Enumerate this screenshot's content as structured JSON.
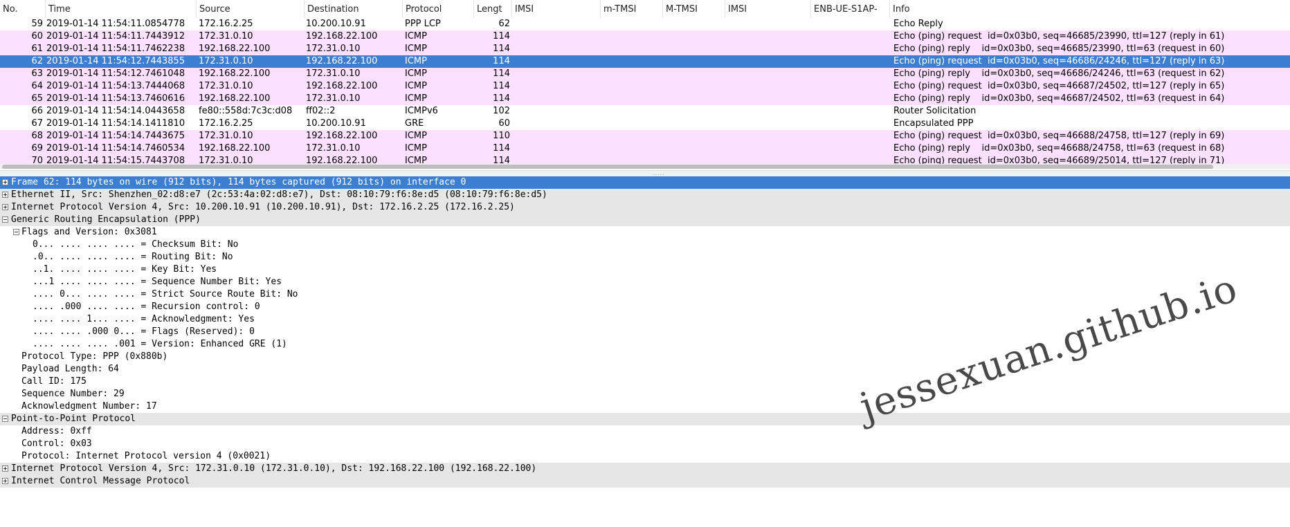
{
  "columns": [
    "No.",
    "Time",
    "Source",
    "Destination",
    "Protocol",
    "Lengt",
    "IMSI",
    "m-TMSI",
    "M-TMSI",
    "IMSI",
    "ENB-UE-S1AP-",
    "Info"
  ],
  "packets": [
    {
      "no": "59",
      "time": "2019-01-14 11:54:11.0854778",
      "src": "172.16.2.25",
      "dst": "10.200.10.91",
      "proto": "PPP LCP",
      "len": "62",
      "info": "Echo Reply",
      "style": "white"
    },
    {
      "no": "60",
      "time": "2019-01-14 11:54:11.7443912",
      "src": "172.31.0.10",
      "dst": "192.168.22.100",
      "proto": "ICMP",
      "len": "114",
      "info": "Echo (ping) request  id=0x03b0, seq=46685/23990, ttl=127 (reply in 61)",
      "style": "pink"
    },
    {
      "no": "61",
      "time": "2019-01-14 11:54:11.7462238",
      "src": "192.168.22.100",
      "dst": "172.31.0.10",
      "proto": "ICMP",
      "len": "114",
      "info": "Echo (ping) reply    id=0x03b0, seq=46685/23990, ttl=63 (request in 60)",
      "style": "pink"
    },
    {
      "no": "62",
      "time": "2019-01-14 11:54:12.7443855",
      "src": "172.31.0.10",
      "dst": "192.168.22.100",
      "proto": "ICMP",
      "len": "114",
      "info": "Echo (ping) request  id=0x03b0, seq=46686/24246, ttl=127 (reply in 63)",
      "style": "selected"
    },
    {
      "no": "63",
      "time": "2019-01-14 11:54:12.7461048",
      "src": "192.168.22.100",
      "dst": "172.31.0.10",
      "proto": "ICMP",
      "len": "114",
      "info": "Echo (ping) reply    id=0x03b0, seq=46686/24246, ttl=63 (request in 62)",
      "style": "pink"
    },
    {
      "no": "64",
      "time": "2019-01-14 11:54:13.7444068",
      "src": "172.31.0.10",
      "dst": "192.168.22.100",
      "proto": "ICMP",
      "len": "114",
      "info": "Echo (ping) request  id=0x03b0, seq=46687/24502, ttl=127 (reply in 65)",
      "style": "pink"
    },
    {
      "no": "65",
      "time": "2019-01-14 11:54:13.7460616",
      "src": "192.168.22.100",
      "dst": "172.31.0.10",
      "proto": "ICMP",
      "len": "114",
      "info": "Echo (ping) reply    id=0x03b0, seq=46687/24502, ttl=63 (request in 64)",
      "style": "pink"
    },
    {
      "no": "66",
      "time": "2019-01-14 11:54:14.0443658",
      "src": "fe80::558d:7c3c:d08",
      "dst": "ff02::2",
      "proto": "ICMPv6",
      "len": "102",
      "info": "Router Solicitation",
      "style": "white"
    },
    {
      "no": "67",
      "time": "2019-01-14 11:54:14.1411810",
      "src": "172.16.2.25",
      "dst": "10.200.10.91",
      "proto": "GRE",
      "len": "60",
      "info": "Encapsulated PPP",
      "style": "white"
    },
    {
      "no": "68",
      "time": "2019-01-14 11:54:14.7443675",
      "src": "172.31.0.10",
      "dst": "192.168.22.100",
      "proto": "ICMP",
      "len": "110",
      "info": "Echo (ping) request  id=0x03b0, seq=46688/24758, ttl=127 (reply in 69)",
      "style": "pink"
    },
    {
      "no": "69",
      "time": "2019-01-14 11:54:14.7460534",
      "src": "192.168.22.100",
      "dst": "172.31.0.10",
      "proto": "ICMP",
      "len": "114",
      "info": "Echo (ping) reply    id=0x03b0, seq=46688/24758, ttl=63 (request in 68)",
      "style": "pink"
    },
    {
      "no": "70",
      "time": "2019-01-14 11:54:15.7443708",
      "src": "172.31.0.10",
      "dst": "192.168.22.100",
      "proto": "ICMP",
      "len": "114",
      "info": "Echo (ping) request  id=0x03b0, seq=46689/25014, ttl=127 (reply in 71)",
      "style": "pink"
    }
  ],
  "details": [
    {
      "indent": 0,
      "toggle": "plus",
      "text": "Frame 62: 114 bytes on wire (912 bits), 114 bytes captured (912 bits) on interface 0",
      "style": "selected"
    },
    {
      "indent": 0,
      "toggle": "plus",
      "text": "Ethernet II, Src: Shenzhen_02:d8:e7 (2c:53:4a:02:d8:e7), Dst: 08:10:79:f6:8e:d5 (08:10:79:f6:8e:d5)",
      "style": "header"
    },
    {
      "indent": 0,
      "toggle": "plus",
      "text": "Internet Protocol Version 4, Src: 10.200.10.91 (10.200.10.91), Dst: 172.16.2.25 (172.16.2.25)",
      "style": "header"
    },
    {
      "indent": 0,
      "toggle": "minus",
      "text": "Generic Routing Encapsulation (PPP)",
      "style": "header"
    },
    {
      "indent": 1,
      "toggle": "minus",
      "text": "Flags and Version: 0x3081",
      "style": "plain"
    },
    {
      "indent": 2,
      "toggle": "none",
      "text": "0... .... .... .... = Checksum Bit: No",
      "style": "plain"
    },
    {
      "indent": 2,
      "toggle": "none",
      "text": ".0.. .... .... .... = Routing Bit: No",
      "style": "plain"
    },
    {
      "indent": 2,
      "toggle": "none",
      "text": "..1. .... .... .... = Key Bit: Yes",
      "style": "plain"
    },
    {
      "indent": 2,
      "toggle": "none",
      "text": "...1 .... .... .... = Sequence Number Bit: Yes",
      "style": "plain"
    },
    {
      "indent": 2,
      "toggle": "none",
      "text": ".... 0... .... .... = Strict Source Route Bit: No",
      "style": "plain"
    },
    {
      "indent": 2,
      "toggle": "none",
      "text": ".... .000 .... .... = Recursion control: 0",
      "style": "plain"
    },
    {
      "indent": 2,
      "toggle": "none",
      "text": ".... .... 1... .... = Acknowledgment: Yes",
      "style": "plain"
    },
    {
      "indent": 2,
      "toggle": "none",
      "text": ".... .... .000 0... = Flags (Reserved): 0",
      "style": "plain"
    },
    {
      "indent": 2,
      "toggle": "none",
      "text": ".... .... .... .001 = Version: Enhanced GRE (1)",
      "style": "plain"
    },
    {
      "indent": 1,
      "toggle": "none",
      "text": "Protocol Type: PPP (0x880b)",
      "style": "plain"
    },
    {
      "indent": 1,
      "toggle": "none",
      "text": "Payload Length: 64",
      "style": "plain"
    },
    {
      "indent": 1,
      "toggle": "none",
      "text": "Call ID: 175",
      "style": "plain"
    },
    {
      "indent": 1,
      "toggle": "none",
      "text": "Sequence Number: 29",
      "style": "plain"
    },
    {
      "indent": 1,
      "toggle": "none",
      "text": "Acknowledgment Number: 17",
      "style": "plain"
    },
    {
      "indent": 0,
      "toggle": "minus",
      "text": "Point-to-Point Protocol",
      "style": "header"
    },
    {
      "indent": 1,
      "toggle": "none",
      "text": "Address: 0xff",
      "style": "plain"
    },
    {
      "indent": 1,
      "toggle": "none",
      "text": "Control: 0x03",
      "style": "plain"
    },
    {
      "indent": 1,
      "toggle": "none",
      "text": "Protocol: Internet Protocol version 4 (0x0021)",
      "style": "plain"
    },
    {
      "indent": 0,
      "toggle": "plus",
      "text": "Internet Protocol Version 4, Src: 172.31.0.10 (172.31.0.10), Dst: 192.168.22.100 (192.168.22.100)",
      "style": "header"
    },
    {
      "indent": 0,
      "toggle": "plus",
      "text": "Internet Control Message Protocol",
      "style": "header"
    }
  ],
  "watermark": "jessexuan.github.io",
  "colors": {
    "pink": "#fce0ff",
    "white": "#ffffff",
    "selected": "#3c7fd0",
    "selected_text": "#ffffff",
    "header_row": "#e6e6e6"
  }
}
